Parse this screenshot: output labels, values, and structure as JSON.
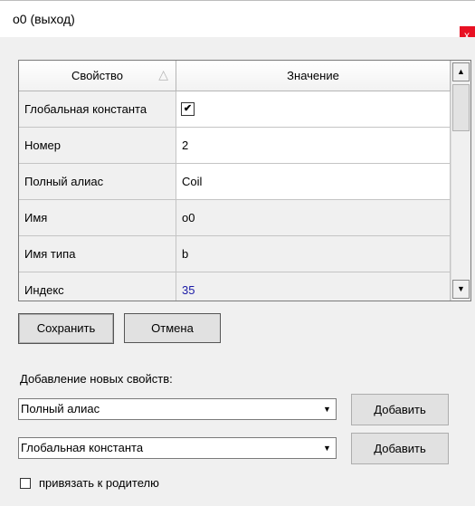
{
  "window": {
    "title": "o0 (выход)",
    "close_label": "x"
  },
  "grid": {
    "columns": {
      "property": "Свойство",
      "value": "Значение"
    },
    "rows": [
      {
        "property": "Глобальная константа",
        "value": "",
        "checkbox": true,
        "checked_mark": "✔"
      },
      {
        "property": "Номер",
        "value": "2"
      },
      {
        "property": "Полный алиас",
        "value": "Coil"
      },
      {
        "property": "Имя",
        "value": "o0"
      },
      {
        "property": "Имя типа",
        "value": "b"
      },
      {
        "property": "Индекс",
        "value": "35"
      }
    ]
  },
  "buttons": {
    "save": "Сохранить",
    "cancel": "Отмена"
  },
  "add_section": {
    "label": "Добавление новых свойств:",
    "combo1_value": "Полный алиас",
    "combo2_value": "Глобальная константа",
    "add_label": "Добавить"
  },
  "bind_parent": {
    "label": "привязать к родителю",
    "checked": false
  }
}
